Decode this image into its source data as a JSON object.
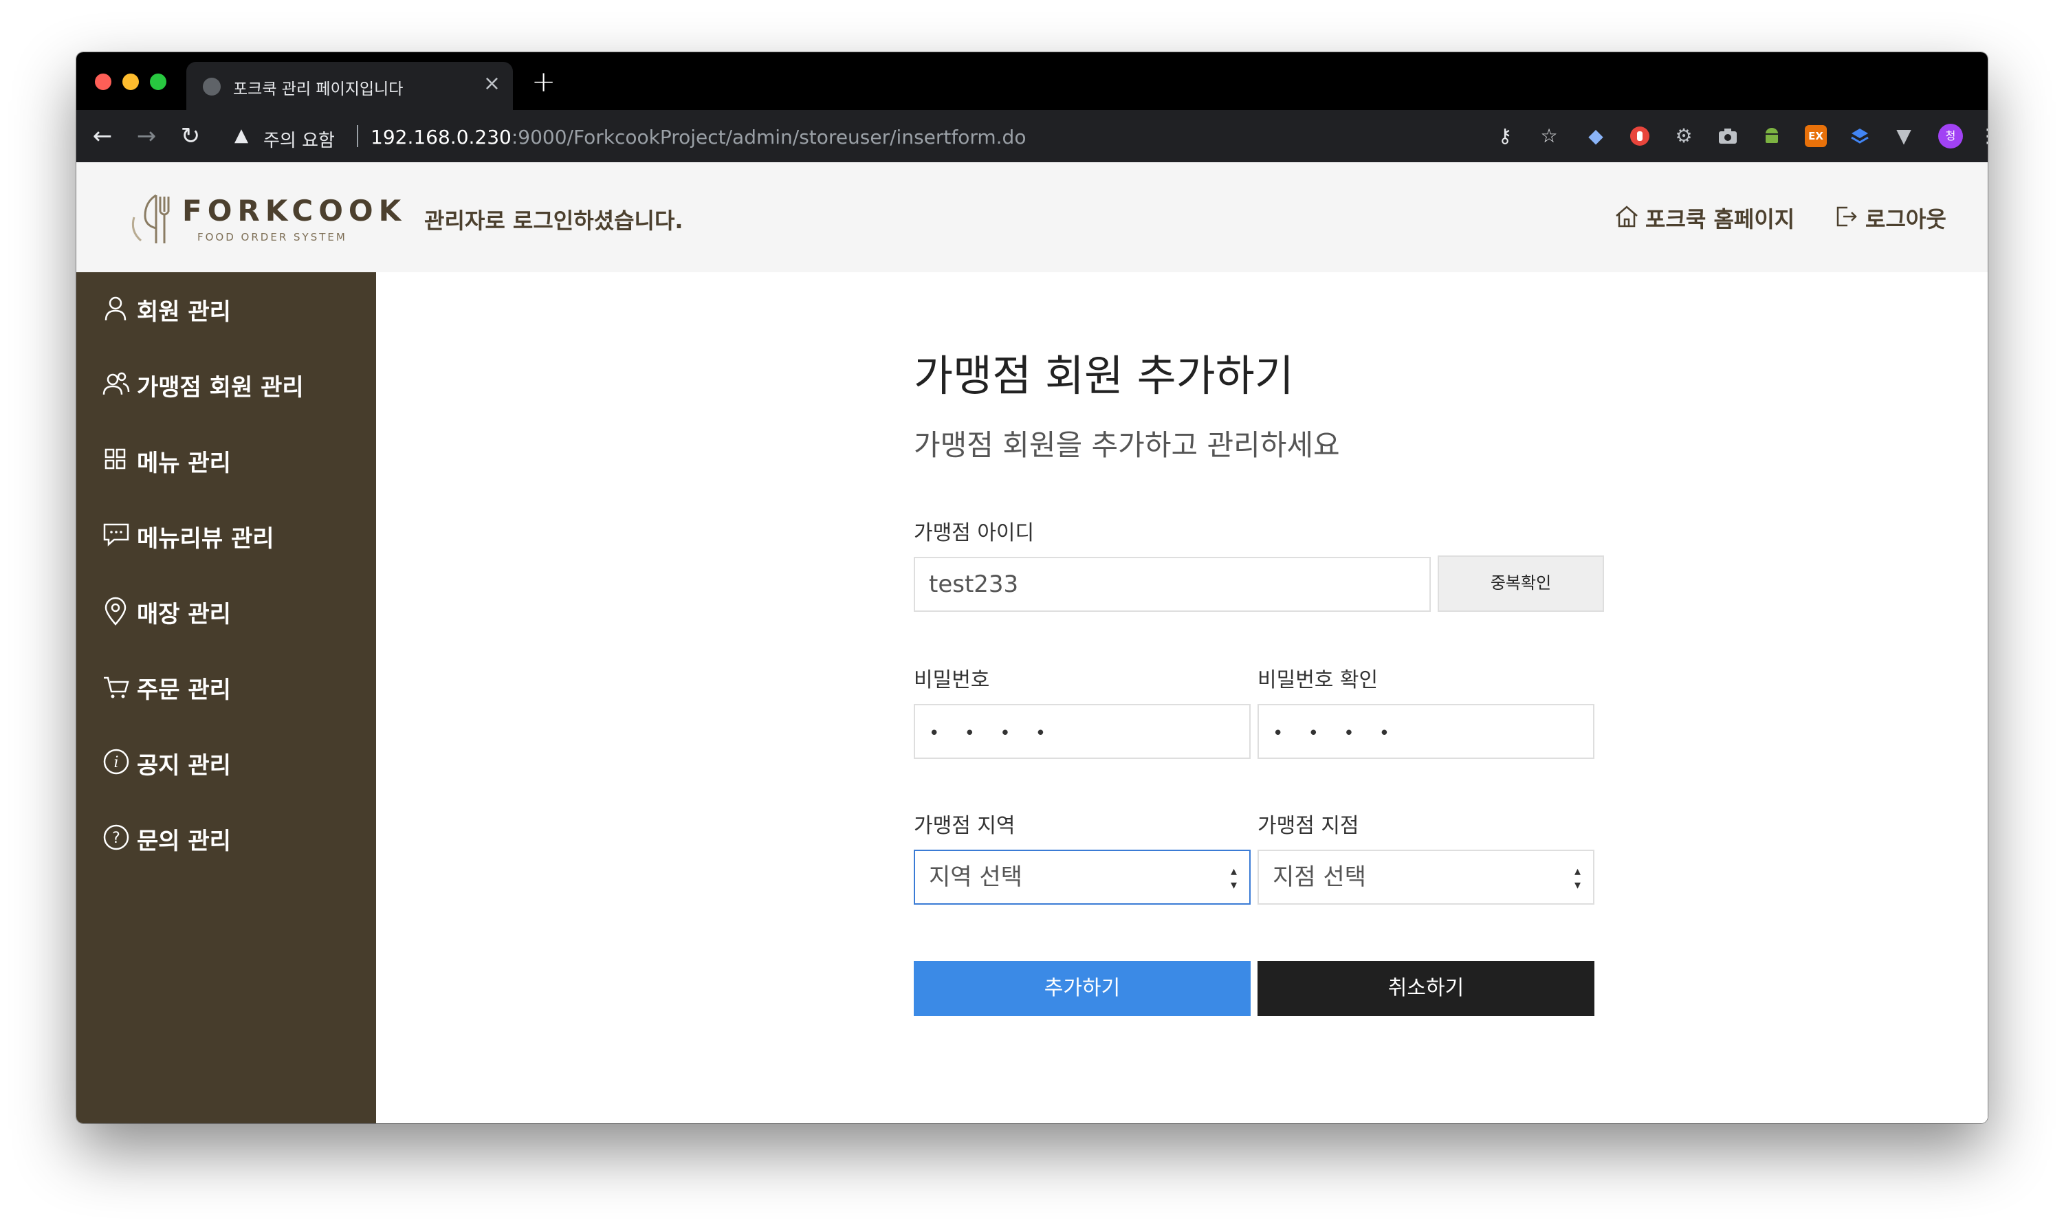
{
  "browser": {
    "tab_title": "포크쿡 관리 페이지입니다",
    "close_glyph": "×",
    "new_tab_glyph": "+",
    "security_label": "주의 요함",
    "url_host": "192.168.0.230",
    "url_rest": ":9000/ForkcookProject/admin/storeuser/insertform.do",
    "profile_initial": "청",
    "ext_ex_label": "EX"
  },
  "header": {
    "logo_word": "FORKCOOK",
    "logo_sub": "FOOD ORDER SYSTEM",
    "welcome": "관리자로 로그인하셨습니다.",
    "home_link": "포크쿡 홈페이지",
    "logout_link": "로그아웃"
  },
  "sidebar": {
    "items": [
      {
        "label": "회원 관리",
        "icon": "user-icon"
      },
      {
        "label": "가맹점 회원 관리",
        "icon": "users-icon"
      },
      {
        "label": "메뉴 관리",
        "icon": "grid-icon"
      },
      {
        "label": "메뉴리뷰 관리",
        "icon": "chat-icon"
      },
      {
        "label": "매장 관리",
        "icon": "map-pin-icon"
      },
      {
        "label": "주문 관리",
        "icon": "cart-icon"
      },
      {
        "label": "공지 관리",
        "icon": "info-icon"
      },
      {
        "label": "문의 관리",
        "icon": "question-icon"
      }
    ]
  },
  "form": {
    "title": "가맹점 회원 추가하기",
    "subtitle": "가맹점 회원을 추가하고 관리하세요",
    "id_label": "가맹점 아이디",
    "id_value": "test233",
    "dup_check_label": "중복확인",
    "password_label": "비밀번호",
    "password_value": "• • • •",
    "password_confirm_label": "비밀번호 확인",
    "password_confirm_value": "• • • •",
    "region_label": "가맹점 지역",
    "region_value": "지역 선택",
    "branch_label": "가맹점 지점",
    "branch_value": "지점 선택",
    "submit_label": "추가하기",
    "cancel_label": "취소하기"
  }
}
